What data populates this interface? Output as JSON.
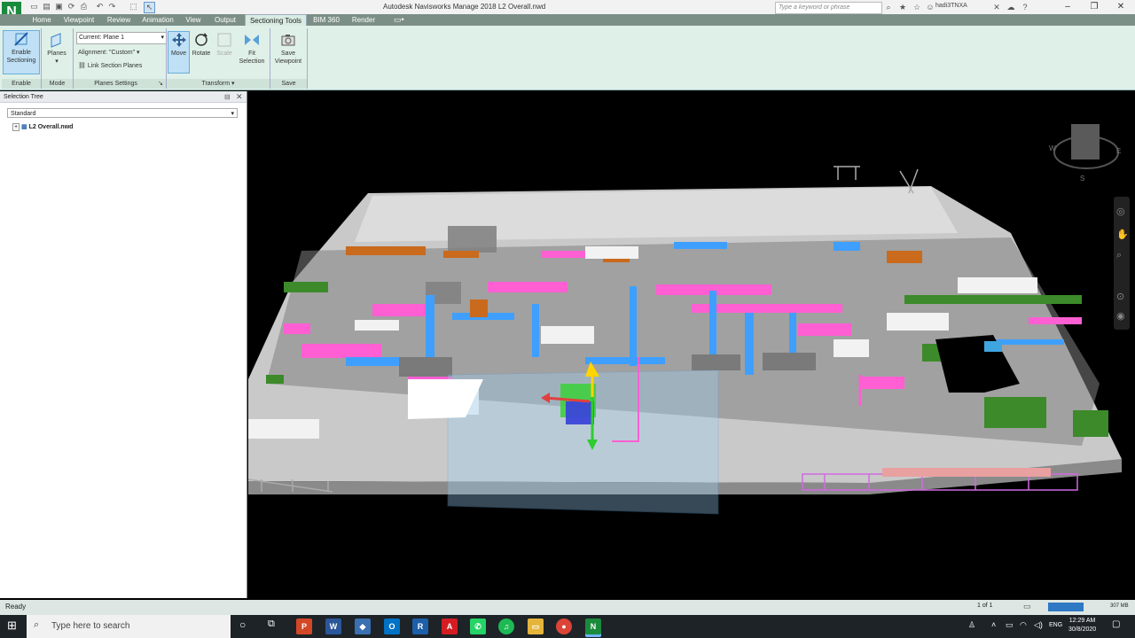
{
  "window": {
    "title": "Autodesk Navisworks Manage 2018    L2 Overall.nwd",
    "search_placeholder": "Type a keyword or phrase",
    "user": "hadi3TNXA",
    "logo": "N"
  },
  "ribbon": {
    "tabs": [
      "Home",
      "Viewpoint",
      "Review",
      "Animation",
      "View",
      "Output",
      "Sectioning Tools",
      "BIM 360",
      "Render"
    ],
    "active_tab": "Sectioning Tools",
    "enable_sectioning": "Enable\nSectioning",
    "planes": "Planes",
    "current_plane": "Current: Plane 1",
    "alignment": "Alignment: \"Custom\"",
    "link_section_planes": "Link Section Planes",
    "move": "Move",
    "rotate": "Rotate",
    "scale": "Scale",
    "fit_selection": "Fit\nSelection",
    "save_viewpoint": "Save\nViewpoint",
    "groups": {
      "enable": "Enable",
      "mode": "Mode",
      "planes_settings": "Planes Settings",
      "transform": "Transform",
      "save": "Save"
    }
  },
  "selection_tree": {
    "title": "Selection Tree",
    "dropdown": "Standard",
    "root_item": "L2 Overall.nwd"
  },
  "viewcube": {
    "w": "W",
    "e": "E",
    "s": "S"
  },
  "status": {
    "text": "Ready",
    "page": "1 of 1",
    "memory": "307 MB"
  },
  "taskbar": {
    "search_placeholder": "Type here to search",
    "lang": "ENG",
    "time": "12:29 AM",
    "date": "30/8/2020",
    "apps": [
      {
        "name": "powerpoint",
        "label": "P",
        "color": "#d24726"
      },
      {
        "name": "word",
        "label": "W",
        "color": "#2b579a"
      },
      {
        "name": "app-blue",
        "label": "◆",
        "color": "#3a6fb0"
      },
      {
        "name": "outlook",
        "label": "O",
        "color": "#0072c6"
      },
      {
        "name": "revit",
        "label": "R",
        "color": "#1d5fa8"
      },
      {
        "name": "acrobat",
        "label": "A",
        "color": "#d41d22"
      },
      {
        "name": "whatsapp",
        "label": "✆",
        "color": "#25d366"
      },
      {
        "name": "spotify",
        "label": "♫",
        "color": "#1db954"
      },
      {
        "name": "explorer",
        "label": "▭",
        "color": "#e5b43a"
      },
      {
        "name": "chrome",
        "label": "●",
        "color": "#db4437"
      },
      {
        "name": "navisworks",
        "label": "N",
        "color": "#1a8a3c"
      }
    ]
  }
}
